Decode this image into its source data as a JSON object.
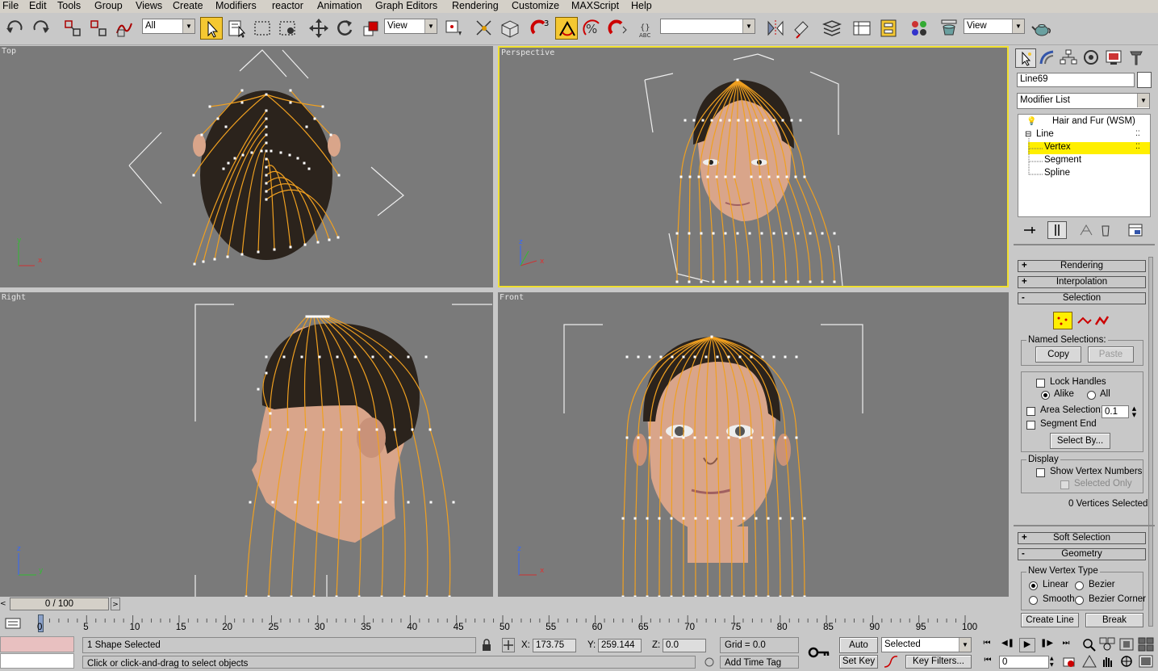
{
  "menu": [
    "File",
    "Edit",
    "Tools",
    "Group",
    "Views",
    "Create",
    "Modifiers",
    "reactor",
    "Animation",
    "Graph Editors",
    "Rendering",
    "Customize",
    "MAXScript",
    "Help"
  ],
  "toolbar": {
    "selection_filter": "All",
    "ref_coord_1": "View",
    "named_sel": "",
    "ref_coord_2": "View",
    "snap_angle_label": "3",
    "named_sel_label": "ABC"
  },
  "viewports": {
    "top": "Top",
    "perspective": "Perspective",
    "right": "Right",
    "front": "Front"
  },
  "axes": {
    "x": "x",
    "y": "y",
    "z": "z"
  },
  "command_panel": {
    "object_name": "Line69",
    "modifier_list": "Modifier List",
    "stack": [
      "Hair and Fur (WSM)",
      "Line",
      "Vertex",
      "Segment",
      "Spline"
    ],
    "rollouts": {
      "rendering": "Rendering",
      "interpolation": "Interpolation",
      "selection": "Selection",
      "soft_selection": "Soft Selection",
      "geometry": "Geometry"
    },
    "named_selections": "Named Selections:",
    "copy": "Copy",
    "paste": "Paste",
    "lock_handles": "Lock Handles",
    "alike": "Alike",
    "all": "All",
    "area_selection": "Area Selection:",
    "area_value": "0.1",
    "segment_end": "Segment End",
    "select_by": "Select By...",
    "display": "Display",
    "show_vertex_numbers": "Show Vertex Numbers",
    "selected_only": "Selected Only",
    "vertices_selected": "0 Vertices Selected",
    "new_vertex_type": "New Vertex Type",
    "linear": "Linear",
    "bezier": "Bezier",
    "smooth": "Smooth",
    "bezier_corner": "Bezier Corner",
    "create_line": "Create Line",
    "break": "Break"
  },
  "timeline": {
    "frame": "0 / 100",
    "ticks": [
      "0",
      "5",
      "10",
      "15",
      "20",
      "25",
      "30",
      "35",
      "40",
      "45",
      "50",
      "55",
      "60",
      "65",
      "70",
      "75",
      "80",
      "85",
      "90",
      "95",
      "100"
    ]
  },
  "status": {
    "selected_count": "1 Shape Selected",
    "prompt": "Click or click-and-drag to select objects",
    "x_label": "X:",
    "x_value": "173.75",
    "y_label": "Y:",
    "y_value": "259.144",
    "z_label": "Z:",
    "z_value": "0.0",
    "grid": "Grid = 0.0",
    "add_time_tag": "Add Time Tag",
    "auto_key": "Auto Key",
    "set_key": "Set Key",
    "key_mode": "Selected",
    "key_filters": "Key Filters...",
    "current_frame": "0"
  },
  "colors": {
    "viewport": "#7a7a7a",
    "active_border": "#f0e030",
    "spline": "#f0a020",
    "skin": "#d9a58a",
    "hair": "#2a201a",
    "highlight": "#ffef00"
  }
}
